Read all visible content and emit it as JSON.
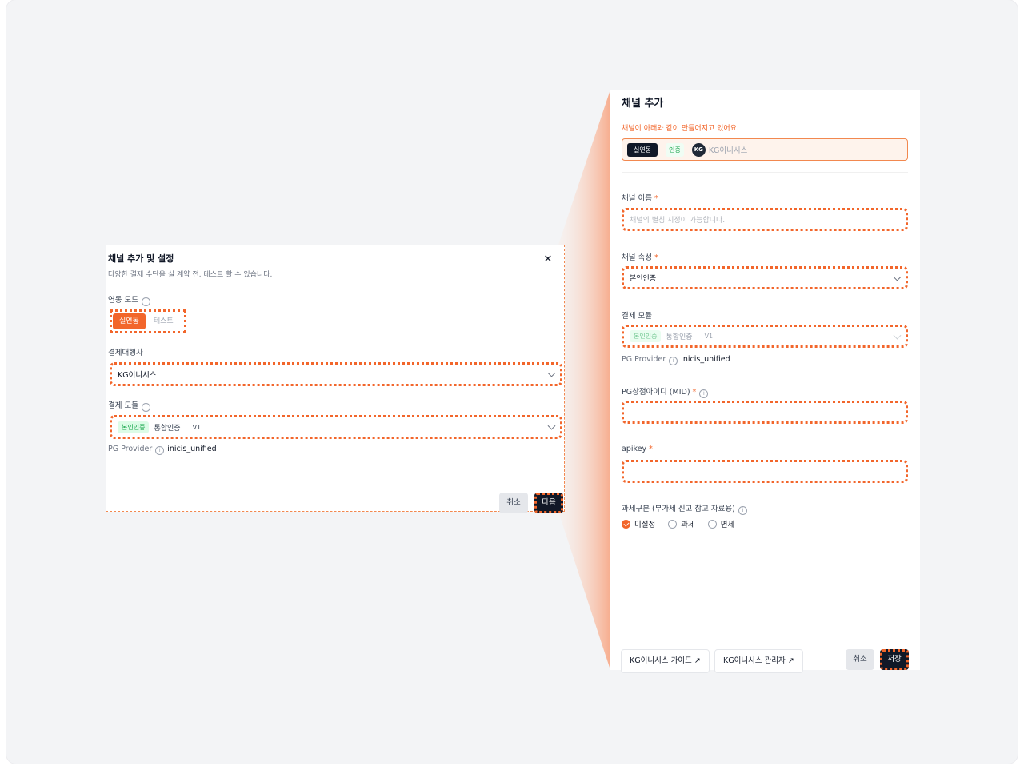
{
  "left_panel": {
    "title": "채널 추가 및 설정",
    "subtitle": "다양한 결제 수단을 실 계약 전, 테스트 할 수 있습니다.",
    "close_icon": "✕",
    "mode_label": "연동 모드",
    "mode_options": [
      "실연동",
      "테스트"
    ],
    "pg_label": "결제대행사",
    "pg_value": "KG이니시스",
    "module_label": "결제 모듈",
    "module_tag": "본인인증",
    "module_name": "통합인증",
    "module_version": "V1",
    "provider_label": "PG Provider",
    "provider_value": "inicis_unified",
    "cancel": "취소",
    "next": "다음"
  },
  "right_panel": {
    "title": "채널 추가",
    "notice": "채널이 아래와 같이 만들어지고 있어요.",
    "summary": {
      "mode": "실연동",
      "type": "인증",
      "pg_logo": "KG",
      "pg_name": "KG이니시스"
    },
    "name_label": "채널 이름",
    "name_placeholder": "채널의 별칭 지정이 가능합니다.",
    "attr_label": "채널 속성",
    "attr_value": "본인인증",
    "module_label": "결제 모듈",
    "module_tag": "본인인증",
    "module_name": "통합인증",
    "module_version": "V1",
    "provider_label": "PG Provider",
    "provider_value": "inicis_unified",
    "mid_label": "PG상점아이디 (MID)",
    "apikey_label": "apikey",
    "required_mark": "*",
    "tax_label": "과세구분 (부가세 신고 참고 자료용)",
    "tax_options": [
      "미설정",
      "과세",
      "면세"
    ],
    "guide_button": "KG이니시스 가이드 ↗",
    "admin_button": "KG이니시스 관리자 ↗",
    "cancel": "취소",
    "save": "저장"
  },
  "colors": {
    "accent": "#f2662b",
    "dark": "#111827",
    "green": "#16a34a"
  }
}
